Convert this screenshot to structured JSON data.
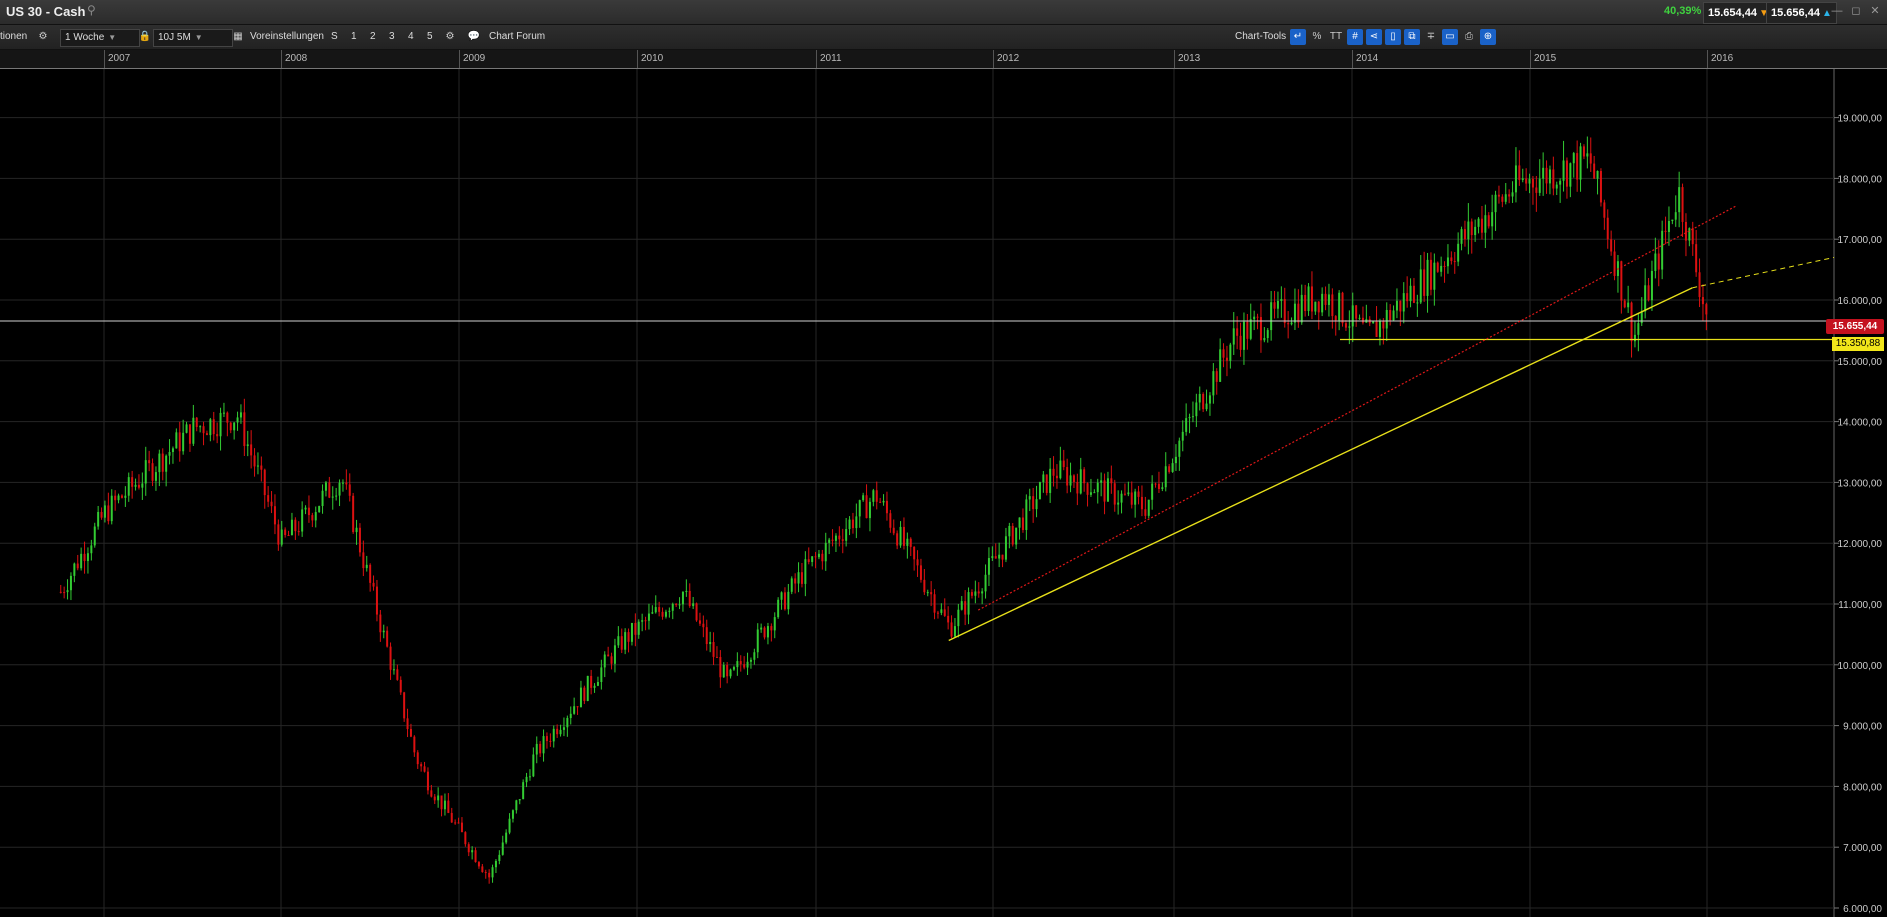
{
  "window": {
    "title": "US 30 - Cash",
    "change_pct": "40,39%",
    "bid": "15.654,44",
    "ask": "15.656,44"
  },
  "toolbar": {
    "options_label": "tionen",
    "interval": "1 Woche",
    "range": "10J 5M",
    "presets_label": "Voreinstellungen",
    "buttons": [
      "S",
      "1",
      "2",
      "3",
      "4",
      "5"
    ],
    "forum_label": "Chart Forum",
    "chart_tools_label": "Chart-Tools",
    "tool_percent": "%",
    "tool_text": "TT",
    "tool_hash": "#"
  },
  "chart_data": {
    "type": "candlestick",
    "instrument": "US 30 - Cash",
    "interval": "1 Woche",
    "x_labels": [
      "2007",
      "2008",
      "2009",
      "2010",
      "2011",
      "2012",
      "2013",
      "2014",
      "2015",
      "2016"
    ],
    "y_ticks": [
      "19.000,00",
      "18.000,00",
      "17.000,00",
      "16.000,00",
      "15.000,00",
      "14.000,00",
      "13.000,00",
      "12.000,00",
      "11.000,00",
      "10.000,00",
      "9.000,00",
      "8.000,00",
      "7.000,00",
      "6.000,00"
    ],
    "ylim": [
      6000,
      19000
    ],
    "last_price": "15.655,44",
    "horizontal_level": "15.350,88",
    "up_color": "#33cc33",
    "down_color": "#dd1111",
    "trendline_color": "#e8e01a",
    "channel_color": "#e01818",
    "key_points": [
      {
        "date": "2006-10",
        "value": 11200
      },
      {
        "date": "2007-01",
        "value": 12500
      },
      {
        "date": "2007-07",
        "value": 13900
      },
      {
        "date": "2007-10",
        "value": 14100
      },
      {
        "date": "2008-01",
        "value": 12000
      },
      {
        "date": "2008-05",
        "value": 13100
      },
      {
        "date": "2008-10",
        "value": 8500
      },
      {
        "date": "2008-11",
        "value": 8000
      },
      {
        "date": "2009-03",
        "value": 6500
      },
      {
        "date": "2009-06",
        "value": 8500
      },
      {
        "date": "2009-12",
        "value": 10400
      },
      {
        "date": "2010-04",
        "value": 11200
      },
      {
        "date": "2010-07",
        "value": 9700
      },
      {
        "date": "2010-12",
        "value": 11500
      },
      {
        "date": "2011-05",
        "value": 12800
      },
      {
        "date": "2011-10",
        "value": 10600
      },
      {
        "date": "2012-05",
        "value": 13200
      },
      {
        "date": "2012-11",
        "value": 12600
      },
      {
        "date": "2013-05",
        "value": 15400
      },
      {
        "date": "2013-11",
        "value": 16100
      },
      {
        "date": "2014-02",
        "value": 15400
      },
      {
        "date": "2014-12",
        "value": 17900
      },
      {
        "date": "2015-05",
        "value": 18300
      },
      {
        "date": "2015-08",
        "value": 15400
      },
      {
        "date": "2015-11",
        "value": 17800
      },
      {
        "date": "2016-01",
        "value": 15655
      }
    ]
  }
}
